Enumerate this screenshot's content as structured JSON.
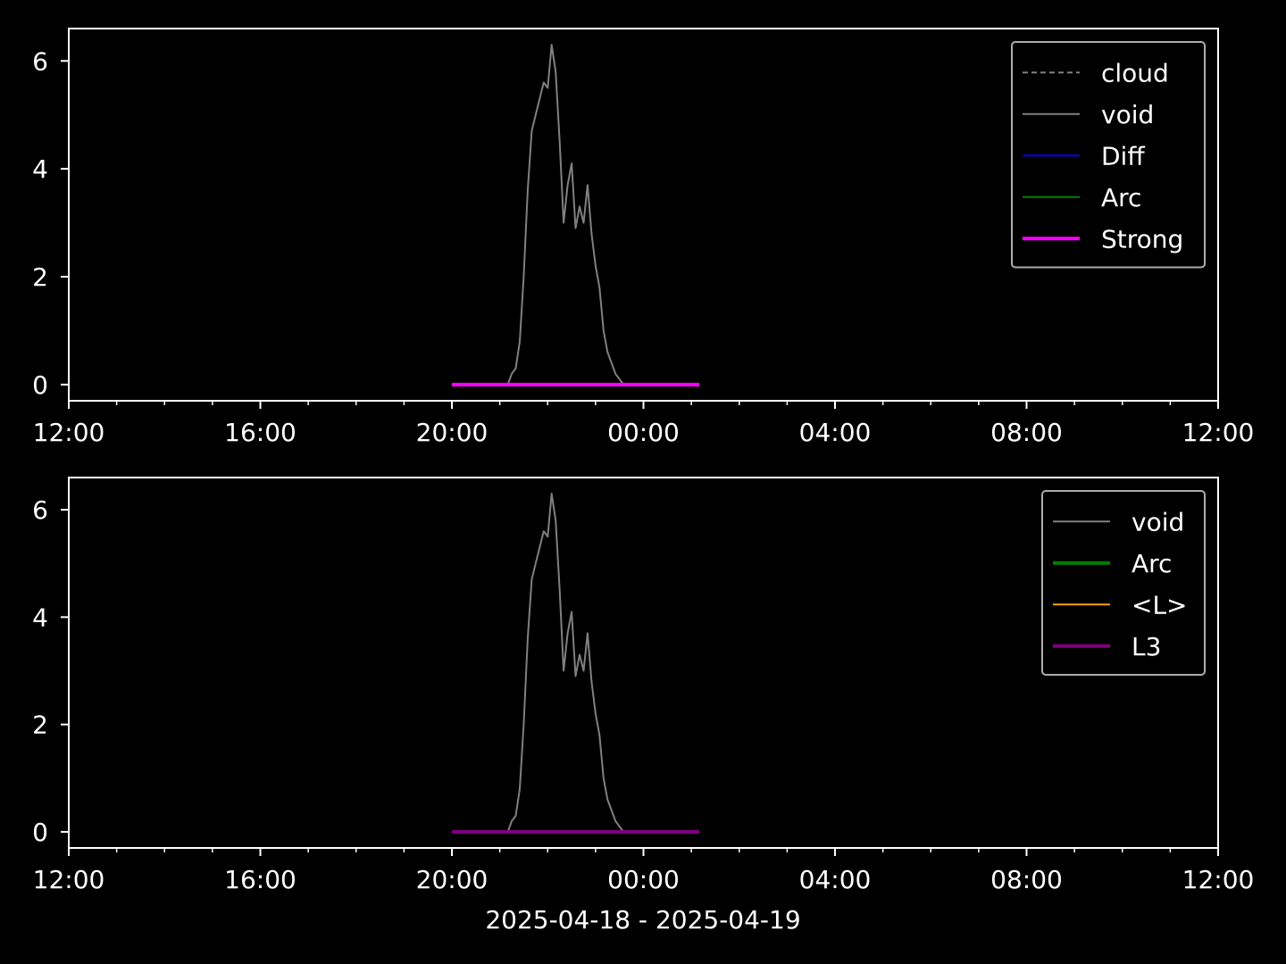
{
  "figure": {
    "background": "#000000",
    "foreground": "#ffffff",
    "xlabel": "2025-04-18 - 2025-04-19"
  },
  "chart_data": [
    {
      "type": "line",
      "x_axis": "time",
      "xlim": [
        "2025-04-18 12:00",
        "2025-04-19 12:00"
      ],
      "ylim": [
        -0.3,
        6.6
      ],
      "xticks": [
        "12:00",
        "16:00",
        "20:00",
        "00:00",
        "04:00",
        "08:00",
        "12:00"
      ],
      "xtick_times": [
        "2025-04-18 12:00",
        "2025-04-18 16:00",
        "2025-04-18 20:00",
        "2025-04-19 00:00",
        "2025-04-19 04:00",
        "2025-04-19 08:00",
        "2025-04-19 12:00"
      ],
      "minor_xtick_hours": 1,
      "yticks": [
        0,
        2,
        4,
        6
      ],
      "grid": false,
      "legend_position": "top-right",
      "legend": [
        {
          "label": "cloud",
          "color": "#808080",
          "style": "dashed",
          "width": "thin"
        },
        {
          "label": "void",
          "color": "#808080",
          "style": "solid",
          "width": "thin"
        },
        {
          "label": "Diff",
          "color": "#0000ff",
          "style": "solid",
          "width": "thin"
        },
        {
          "label": "Arc",
          "color": "#008000",
          "style": "solid",
          "width": "thin"
        },
        {
          "label": "Strong",
          "color": "#ff00ff",
          "style": "solid",
          "width": "thick"
        }
      ],
      "series": [
        {
          "name": "void",
          "color": "#808080",
          "style": "solid",
          "points": [
            [
              "2025-04-18 21:10",
              0.0
            ],
            [
              "2025-04-18 21:15",
              0.2
            ],
            [
              "2025-04-18 21:20",
              0.3
            ],
            [
              "2025-04-18 21:25",
              0.8
            ],
            [
              "2025-04-18 21:30",
              2.0
            ],
            [
              "2025-04-18 21:35",
              3.6
            ],
            [
              "2025-04-18 21:40",
              4.7
            ],
            [
              "2025-04-18 21:45",
              5.0
            ],
            [
              "2025-04-18 21:50",
              5.3
            ],
            [
              "2025-04-18 21:55",
              5.6
            ],
            [
              "2025-04-18 22:00",
              5.5
            ],
            [
              "2025-04-18 22:05",
              6.3
            ],
            [
              "2025-04-18 22:10",
              5.8
            ],
            [
              "2025-04-18 22:15",
              4.5
            ],
            [
              "2025-04-18 22:20",
              3.0
            ],
            [
              "2025-04-18 22:25",
              3.7
            ],
            [
              "2025-04-18 22:30",
              4.1
            ],
            [
              "2025-04-18 22:35",
              2.9
            ],
            [
              "2025-04-18 22:40",
              3.3
            ],
            [
              "2025-04-18 22:45",
              3.0
            ],
            [
              "2025-04-18 22:50",
              3.7
            ],
            [
              "2025-04-18 22:55",
              2.8
            ],
            [
              "2025-04-18 23:00",
              2.2
            ],
            [
              "2025-04-18 23:05",
              1.8
            ],
            [
              "2025-04-18 23:10",
              1.0
            ],
            [
              "2025-04-18 23:15",
              0.6
            ],
            [
              "2025-04-18 23:20",
              0.4
            ],
            [
              "2025-04-18 23:25",
              0.2
            ],
            [
              "2025-04-18 23:30",
              0.1
            ],
            [
              "2025-04-18 23:35",
              0.0
            ]
          ]
        },
        {
          "name": "Strong",
          "color": "#ff00ff",
          "style": "solid",
          "width": "thick",
          "points": [
            [
              "2025-04-18 20:00",
              0.0
            ],
            [
              "2025-04-19 01:10",
              0.0
            ]
          ]
        }
      ]
    },
    {
      "type": "line",
      "x_axis": "time",
      "xlim": [
        "2025-04-18 12:00",
        "2025-04-19 12:00"
      ],
      "ylim": [
        -0.3,
        6.6
      ],
      "xticks": [
        "12:00",
        "16:00",
        "20:00",
        "00:00",
        "04:00",
        "08:00",
        "12:00"
      ],
      "xtick_times": [
        "2025-04-18 12:00",
        "2025-04-18 16:00",
        "2025-04-18 20:00",
        "2025-04-19 00:00",
        "2025-04-19 04:00",
        "2025-04-19 08:00",
        "2025-04-19 12:00"
      ],
      "minor_xtick_hours": 1,
      "yticks": [
        0,
        2,
        4,
        6
      ],
      "grid": false,
      "legend_position": "top-right",
      "legend": [
        {
          "label": "void",
          "color": "#808080",
          "style": "solid",
          "width": "thin"
        },
        {
          "label": "Arc",
          "color": "#008000",
          "style": "solid",
          "width": "thick"
        },
        {
          "label": "<L>",
          "color": "#ffa500",
          "style": "solid",
          "width": "thin"
        },
        {
          "label": "L3",
          "color": "#800080",
          "style": "solid",
          "width": "thick"
        }
      ],
      "series": [
        {
          "name": "void",
          "color": "#808080",
          "style": "solid",
          "points": [
            [
              "2025-04-18 21:10",
              0.0
            ],
            [
              "2025-04-18 21:15",
              0.2
            ],
            [
              "2025-04-18 21:20",
              0.3
            ],
            [
              "2025-04-18 21:25",
              0.8
            ],
            [
              "2025-04-18 21:30",
              2.0
            ],
            [
              "2025-04-18 21:35",
              3.6
            ],
            [
              "2025-04-18 21:40",
              4.7
            ],
            [
              "2025-04-18 21:45",
              5.0
            ],
            [
              "2025-04-18 21:50",
              5.3
            ],
            [
              "2025-04-18 21:55",
              5.6
            ],
            [
              "2025-04-18 22:00",
              5.5
            ],
            [
              "2025-04-18 22:05",
              6.3
            ],
            [
              "2025-04-18 22:10",
              5.8
            ],
            [
              "2025-04-18 22:15",
              4.5
            ],
            [
              "2025-04-18 22:20",
              3.0
            ],
            [
              "2025-04-18 22:25",
              3.7
            ],
            [
              "2025-04-18 22:30",
              4.1
            ],
            [
              "2025-04-18 22:35",
              2.9
            ],
            [
              "2025-04-18 22:40",
              3.3
            ],
            [
              "2025-04-18 22:45",
              3.0
            ],
            [
              "2025-04-18 22:50",
              3.7
            ],
            [
              "2025-04-18 22:55",
              2.8
            ],
            [
              "2025-04-18 23:00",
              2.2
            ],
            [
              "2025-04-18 23:05",
              1.8
            ],
            [
              "2025-04-18 23:10",
              1.0
            ],
            [
              "2025-04-18 23:15",
              0.6
            ],
            [
              "2025-04-18 23:20",
              0.4
            ],
            [
              "2025-04-18 23:25",
              0.2
            ],
            [
              "2025-04-18 23:30",
              0.1
            ],
            [
              "2025-04-18 23:35",
              0.0
            ]
          ]
        },
        {
          "name": "L3",
          "color": "#800080",
          "style": "solid",
          "width": "thick",
          "points": [
            [
              "2025-04-18 20:00",
              0.0
            ],
            [
              "2025-04-19 01:10",
              0.0
            ]
          ]
        }
      ]
    }
  ]
}
